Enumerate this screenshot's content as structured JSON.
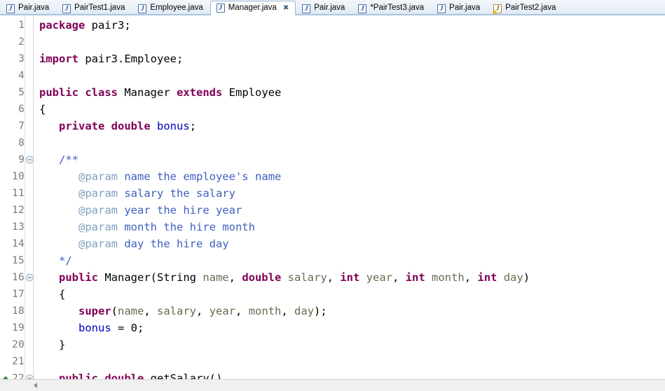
{
  "tabbar": {
    "tabs": [
      {
        "label": "Pair.java",
        "icon": "java-file-icon",
        "active": false,
        "dirty": false,
        "warning": false
      },
      {
        "label": "PairTest1.java",
        "icon": "java-file-icon",
        "active": false,
        "dirty": false,
        "warning": false
      },
      {
        "label": "Employee.java",
        "icon": "java-file-icon",
        "active": false,
        "dirty": false,
        "warning": false
      },
      {
        "label": "Manager.java",
        "icon": "java-file-icon",
        "active": true,
        "dirty": false,
        "warning": false,
        "close_glyph": "✖"
      },
      {
        "label": "Pair.java",
        "icon": "java-file-icon",
        "active": false,
        "dirty": false,
        "warning": false
      },
      {
        "label": "*PairTest3.java",
        "icon": "java-file-icon",
        "active": false,
        "dirty": true,
        "warning": false
      },
      {
        "label": "Pair.java",
        "icon": "java-file-icon",
        "active": false,
        "dirty": false,
        "warning": false
      },
      {
        "label": "PairTest2.java",
        "icon": "java-file-warning-icon",
        "active": false,
        "dirty": false,
        "warning": true
      }
    ]
  },
  "editor": {
    "language": "java",
    "file": "Manager.java",
    "lines": [
      {
        "num": "1",
        "fold": false,
        "marker": "",
        "tokens": [
          {
            "t": "package",
            "c": "kw"
          },
          {
            "t": " pair3;",
            "c": "pln"
          }
        ]
      },
      {
        "num": "2",
        "fold": false,
        "marker": "",
        "tokens": []
      },
      {
        "num": "3",
        "fold": false,
        "marker": "",
        "tokens": [
          {
            "t": "import",
            "c": "kw"
          },
          {
            "t": " pair3.Employee;",
            "c": "pln"
          }
        ]
      },
      {
        "num": "4",
        "fold": false,
        "marker": "",
        "tokens": []
      },
      {
        "num": "5",
        "fold": false,
        "marker": "",
        "tokens": [
          {
            "t": "public",
            "c": "kw"
          },
          {
            "t": " ",
            "c": "pln"
          },
          {
            "t": "class",
            "c": "kw"
          },
          {
            "t": " Manager ",
            "c": "pln"
          },
          {
            "t": "extends",
            "c": "kw"
          },
          {
            "t": " Employee",
            "c": "pln"
          }
        ]
      },
      {
        "num": "6",
        "fold": false,
        "marker": "",
        "tokens": [
          {
            "t": "{",
            "c": "pln"
          }
        ]
      },
      {
        "num": "7",
        "fold": false,
        "marker": "",
        "tokens": [
          {
            "t": "   ",
            "c": "pln"
          },
          {
            "t": "private",
            "c": "kw"
          },
          {
            "t": " ",
            "c": "pln"
          },
          {
            "t": "double",
            "c": "kw"
          },
          {
            "t": " ",
            "c": "pln"
          },
          {
            "t": "bonus",
            "c": "fld"
          },
          {
            "t": ";",
            "c": "pln"
          }
        ]
      },
      {
        "num": "8",
        "fold": false,
        "marker": "",
        "tokens": []
      },
      {
        "num": "9",
        "fold": true,
        "marker": "",
        "tokens": [
          {
            "t": "   ",
            "c": "pln"
          },
          {
            "t": "/**",
            "c": "doc"
          }
        ]
      },
      {
        "num": "10",
        "fold": false,
        "marker": "",
        "tokens": [
          {
            "t": "      ",
            "c": "pln"
          },
          {
            "t": "@param",
            "c": "dtag"
          },
          {
            "t": " name the employee's name",
            "c": "doc"
          }
        ]
      },
      {
        "num": "11",
        "fold": false,
        "marker": "",
        "tokens": [
          {
            "t": "      ",
            "c": "pln"
          },
          {
            "t": "@param",
            "c": "dtag"
          },
          {
            "t": " salary the salary",
            "c": "doc"
          }
        ]
      },
      {
        "num": "12",
        "fold": false,
        "marker": "",
        "tokens": [
          {
            "t": "      ",
            "c": "pln"
          },
          {
            "t": "@param",
            "c": "dtag"
          },
          {
            "t": " year the hire year",
            "c": "doc"
          }
        ]
      },
      {
        "num": "13",
        "fold": false,
        "marker": "",
        "tokens": [
          {
            "t": "      ",
            "c": "pln"
          },
          {
            "t": "@param",
            "c": "dtag"
          },
          {
            "t": " month the hire month",
            "c": "doc"
          }
        ]
      },
      {
        "num": "14",
        "fold": false,
        "marker": "",
        "tokens": [
          {
            "t": "      ",
            "c": "pln"
          },
          {
            "t": "@param",
            "c": "dtag"
          },
          {
            "t": " day the hire day",
            "c": "doc"
          }
        ]
      },
      {
        "num": "15",
        "fold": false,
        "marker": "",
        "tokens": [
          {
            "t": "   ",
            "c": "pln"
          },
          {
            "t": "*/",
            "c": "doc"
          }
        ]
      },
      {
        "num": "16",
        "fold": true,
        "marker": "",
        "tokens": [
          {
            "t": "   ",
            "c": "pln"
          },
          {
            "t": "public",
            "c": "kw"
          },
          {
            "t": " Manager(String ",
            "c": "pln"
          },
          {
            "t": "name",
            "c": "prm"
          },
          {
            "t": ", ",
            "c": "pln"
          },
          {
            "t": "double",
            "c": "kw"
          },
          {
            "t": " ",
            "c": "pln"
          },
          {
            "t": "salary",
            "c": "prm"
          },
          {
            "t": ", ",
            "c": "pln"
          },
          {
            "t": "int",
            "c": "kw"
          },
          {
            "t": " ",
            "c": "pln"
          },
          {
            "t": "year",
            "c": "prm"
          },
          {
            "t": ", ",
            "c": "pln"
          },
          {
            "t": "int",
            "c": "kw"
          },
          {
            "t": " ",
            "c": "pln"
          },
          {
            "t": "month",
            "c": "prm"
          },
          {
            "t": ", ",
            "c": "pln"
          },
          {
            "t": "int",
            "c": "kw"
          },
          {
            "t": " ",
            "c": "pln"
          },
          {
            "t": "day",
            "c": "prm"
          },
          {
            "t": ")",
            "c": "pln"
          }
        ]
      },
      {
        "num": "17",
        "fold": false,
        "marker": "",
        "tokens": [
          {
            "t": "   {",
            "c": "pln"
          }
        ]
      },
      {
        "num": "18",
        "fold": false,
        "marker": "",
        "tokens": [
          {
            "t": "      ",
            "c": "pln"
          },
          {
            "t": "super",
            "c": "kw"
          },
          {
            "t": "(",
            "c": "pln"
          },
          {
            "t": "name",
            "c": "prm"
          },
          {
            "t": ", ",
            "c": "pln"
          },
          {
            "t": "salary",
            "c": "prm"
          },
          {
            "t": ", ",
            "c": "pln"
          },
          {
            "t": "year",
            "c": "prm"
          },
          {
            "t": ", ",
            "c": "pln"
          },
          {
            "t": "month",
            "c": "prm"
          },
          {
            "t": ", ",
            "c": "pln"
          },
          {
            "t": "day",
            "c": "prm"
          },
          {
            "t": ");",
            "c": "pln"
          }
        ]
      },
      {
        "num": "19",
        "fold": false,
        "marker": "",
        "tokens": [
          {
            "t": "      ",
            "c": "pln"
          },
          {
            "t": "bonus",
            "c": "fld"
          },
          {
            "t": " = ",
            "c": "pln"
          },
          {
            "t": "0",
            "c": "num"
          },
          {
            "t": ";",
            "c": "pln"
          }
        ]
      },
      {
        "num": "20",
        "fold": false,
        "marker": "",
        "tokens": [
          {
            "t": "   }",
            "c": "pln"
          }
        ]
      },
      {
        "num": "21",
        "fold": false,
        "marker": "",
        "tokens": []
      },
      {
        "num": "22",
        "fold": true,
        "marker": "up-triangle",
        "tokens": [
          {
            "t": "   ",
            "c": "pln"
          },
          {
            "t": "public",
            "c": "kw"
          },
          {
            "t": " ",
            "c": "pln"
          },
          {
            "t": "double",
            "c": "kw"
          },
          {
            "t": " getSalary()",
            "c": "pln"
          }
        ]
      }
    ]
  },
  "scrollbar": {
    "orientation": "horizontal",
    "left_arrow_glyph": "◀"
  },
  "colors": {
    "keyword": "#7f0055",
    "field": "#0000c0",
    "parameter": "#6a6a4f",
    "javadoc": "#3f5fbf",
    "javadoc_tag": "#7f9fbf",
    "plain": "#000000",
    "gutter_text": "#7a7a7a",
    "tab_active_border": "#9cb6d4",
    "tabbar_underline": "#a8c4e0"
  }
}
